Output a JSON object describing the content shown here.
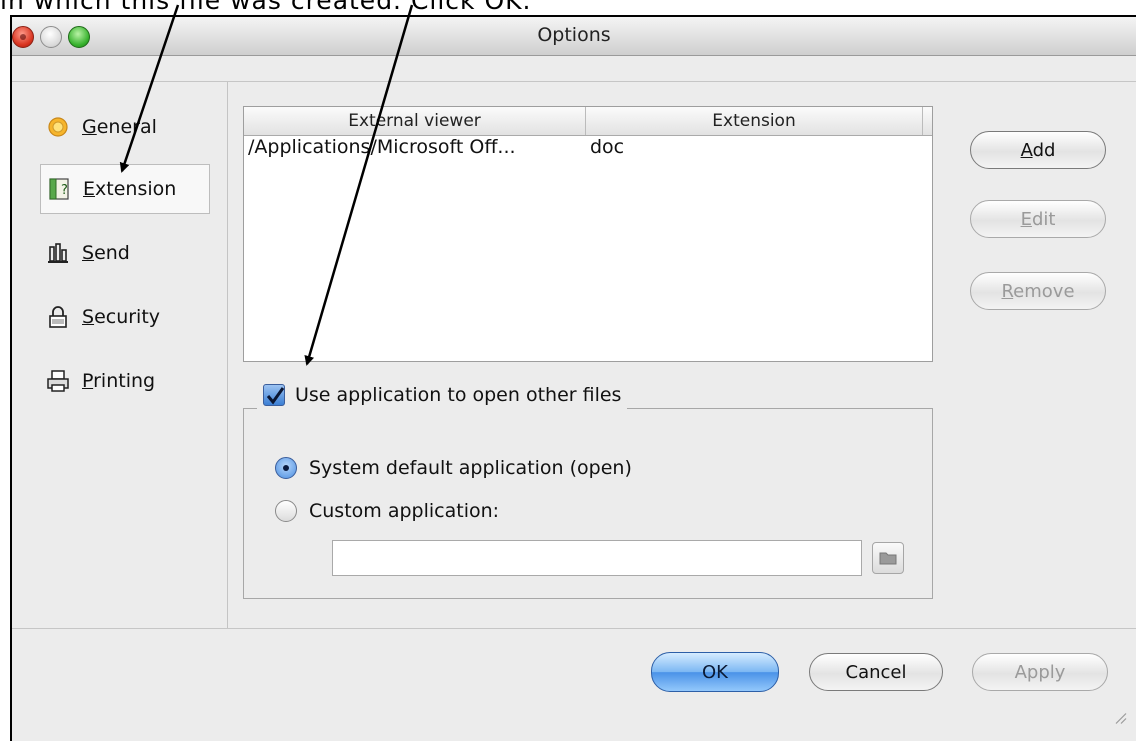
{
  "caption": "in which this file was created. Click OK.",
  "window": {
    "title": "Options"
  },
  "sidebar": {
    "items": [
      {
        "label": "General",
        "icon": "sun-icon",
        "selected": false
      },
      {
        "label": "Extension",
        "icon": "help-book-icon",
        "selected": true
      },
      {
        "label": "Send",
        "icon": "send-tray-icon",
        "selected": false
      },
      {
        "label": "Security",
        "icon": "lock-icon",
        "selected": false
      },
      {
        "label": "Printing",
        "icon": "printer-icon",
        "selected": false
      }
    ]
  },
  "table": {
    "headers": [
      "External viewer",
      "Extension"
    ],
    "rows": [
      [
        "/Applications/Microsoft Off...",
        "doc"
      ]
    ]
  },
  "side_buttons": {
    "add": "Add",
    "edit": "Edit",
    "remove": "Remove"
  },
  "open_group": {
    "checkbox_label": "Use application to open other files",
    "checked": true,
    "radio_system": "System default application (open)",
    "radio_custom": "Custom application:",
    "selected_radio": "system",
    "custom_path_value": ""
  },
  "footer": {
    "ok": "OK",
    "cancel": "Cancel",
    "apply": "Apply"
  },
  "colors": {
    "accent": "#4a92e8",
    "close": "#d8331f",
    "zoom": "#37b22d"
  }
}
